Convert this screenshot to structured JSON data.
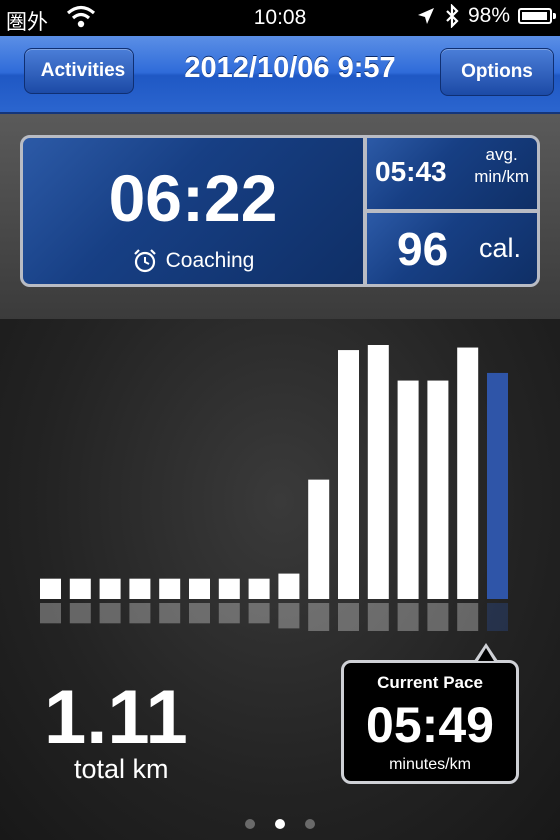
{
  "status_bar": {
    "carrier": "圏外",
    "time": "10:08",
    "battery": "98%",
    "battery_level": 0.98,
    "icons": [
      "wifi-icon",
      "location-arrow-icon",
      "bluetooth-icon",
      "battery-icon"
    ]
  },
  "nav": {
    "back_label": "Activities",
    "title": "2012/10/06 9:57",
    "options_label": "Options"
  },
  "summary": {
    "elapsed_time": "06:22",
    "coaching_label": "Coaching",
    "avg_pace": "05:43",
    "avg_label": "avg.",
    "pace_unit": "min/km",
    "calories": "96",
    "calories_unit": "cal."
  },
  "chart_data": {
    "type": "bar",
    "values": [
      0.08,
      0.08,
      0.08,
      0.08,
      0.08,
      0.08,
      0.08,
      0.08,
      0.1,
      0.47,
      0.98,
      1.0,
      0.86,
      0.86,
      0.99,
      0.89
    ],
    "highlight_index": 15,
    "colors": {
      "bar": "#ffffff",
      "current": "#2f55a8"
    }
  },
  "total": {
    "value": "1.11",
    "label": "total km"
  },
  "current_pace": {
    "title": "Current Pace",
    "value": "05:49",
    "unit": "minutes/km"
  },
  "pager": {
    "count": 3,
    "active": 1
  },
  "colors": {
    "nav_blue": "#2f6bd9",
    "panel_blue": "#173f84",
    "accent_bar": "#2f55a8"
  }
}
